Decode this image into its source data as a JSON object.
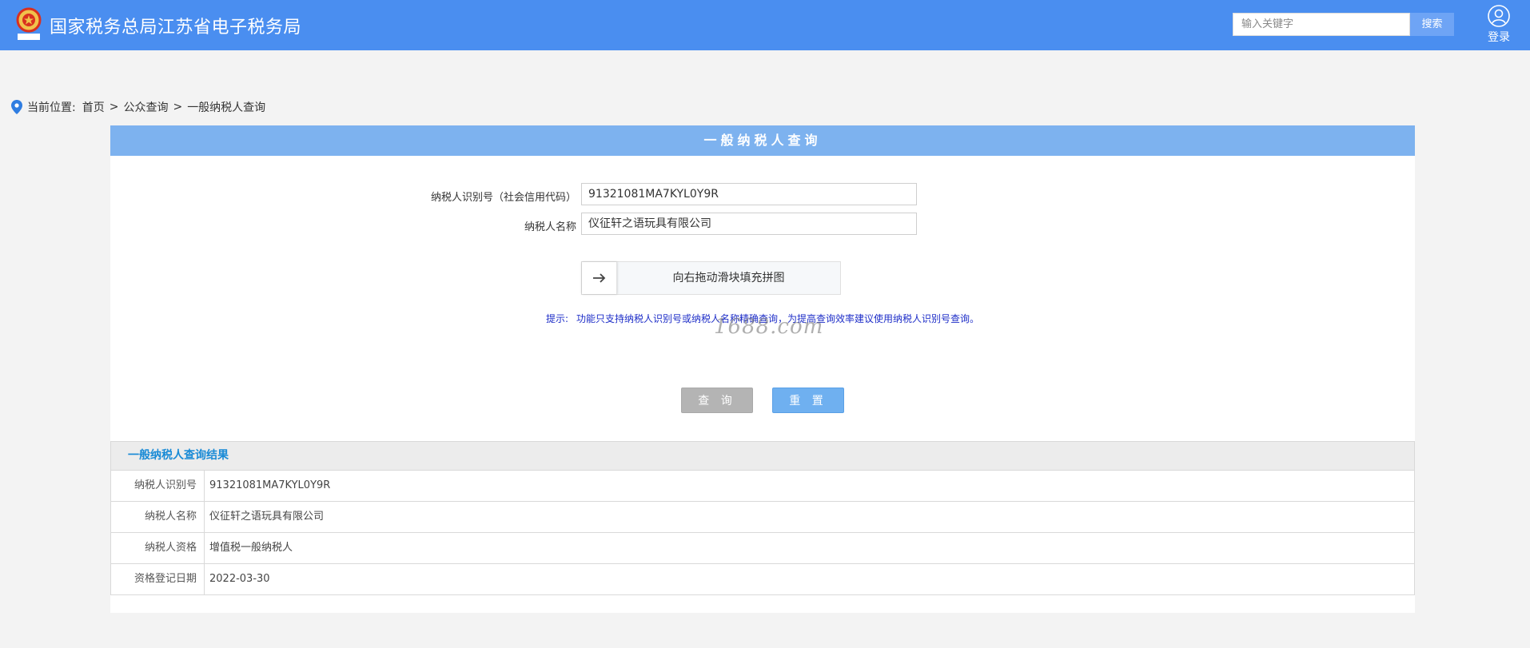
{
  "header": {
    "logo_text": "江苏税务",
    "site_title": "国家税务总局江苏省电子税务局",
    "search_placeholder": "输入关键字",
    "search_button": "搜索",
    "login_label": "登录",
    "brand_color": "#4a8ef0",
    "logo_icon": "tax-emblem-icon",
    "login_icon": "user-icon"
  },
  "breadcrumb": {
    "icon": "location-pin-icon",
    "prefix": "当前位置:",
    "items": [
      "首页",
      "公众查询",
      "一般纳税人查询"
    ],
    "separator": ">"
  },
  "query_panel": {
    "title": "一般纳税人查询",
    "header_color": "#7db2ef",
    "fields": [
      {
        "label": "纳税人识别号（社会信用代码）",
        "value": "91321081MA7KYL0Y9R"
      },
      {
        "label": "纳税人名称",
        "value": "仪征轩之语玩具有限公司"
      }
    ],
    "slider": {
      "handle_icon": "arrow-right-icon",
      "text": "向右拖动滑块填充拼图"
    },
    "tip": {
      "prefix": "提示:",
      "text": "功能只支持纳税人识别号或纳税人名称精确查询，为提高查询效率建议使用纳税人识别号查询。"
    },
    "watermark": "1688.com",
    "buttons": {
      "query": "查 询",
      "reset": "重 置"
    }
  },
  "result": {
    "title": "一般纳税人查询结果",
    "rows": [
      {
        "label": "纳税人识别号",
        "value": "91321081MA7KYL0Y9R"
      },
      {
        "label": "纳税人名称",
        "value": "仪征轩之语玩具有限公司"
      },
      {
        "label": "纳税人资格",
        "value": "增值税一般纳税人"
      },
      {
        "label": "资格登记日期",
        "value": "2022-03-30"
      }
    ]
  }
}
